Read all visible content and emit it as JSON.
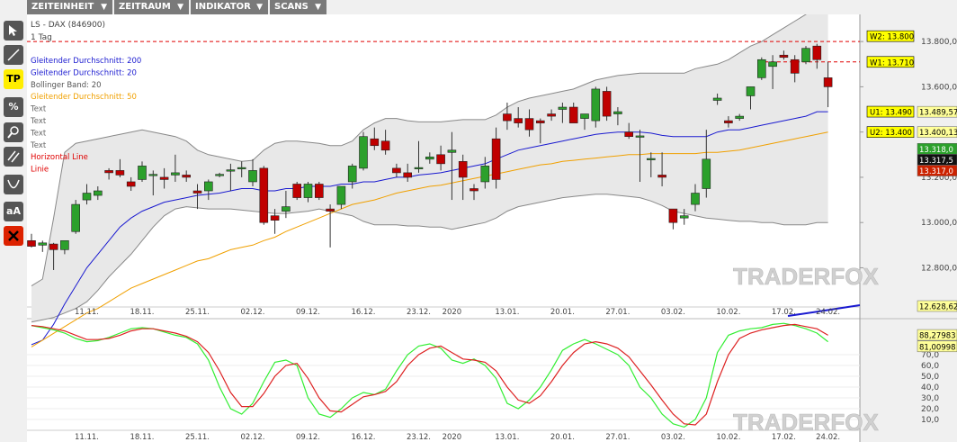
{
  "menu": [
    {
      "label": "ZEITEINHEIT"
    },
    {
      "label": "ZEITRAUM"
    },
    {
      "label": "INDIKATOR"
    },
    {
      "label": "SCANS"
    }
  ],
  "tools": {
    "tp": "TP",
    "percent": "%",
    "text_size": "aA"
  },
  "info": {
    "instrument": "LS - DAX (846900)",
    "timeframe": "1 Tag",
    "legend": [
      {
        "label": "Gleitender Durchschnitt: 200",
        "color": "#1a1ad0"
      },
      {
        "label": "Gleitender Durchschnitt: 20",
        "color": "#1a1ad0"
      },
      {
        "label": "Bollinger Band: 20",
        "color": "#555555"
      },
      {
        "label": "Gleitender Durchschnitt: 50",
        "color": "#f0a000"
      },
      {
        "label": "Text",
        "color": "#666666"
      },
      {
        "label": "Text",
        "color": "#666666"
      },
      {
        "label": "Text",
        "color": "#666666"
      },
      {
        "label": "Text",
        "color": "#666666"
      },
      {
        "label": "Horizontal Line",
        "color": "#e00000"
      },
      {
        "label": "Linie",
        "color": "#e00000"
      }
    ]
  },
  "watermark": "TRADERFOX",
  "price_tags": [
    {
      "text": "W2: 13.800",
      "bg": "#ffff00"
    },
    {
      "text": "W1: 13.710",
      "bg": "#ffff00"
    },
    {
      "text": "U1: 13.490",
      "bg": "#ffff00"
    },
    {
      "text": "U2: 13.400",
      "bg": "#ffff00"
    }
  ],
  "axis_values": [
    {
      "text": "13.489,57",
      "bg": "#ffff99",
      "color": "#000000"
    },
    {
      "text": "13.400,13",
      "bg": "#ffff99",
      "color": "#000000"
    },
    {
      "text": "13.318,0",
      "bg": "#2ca02c",
      "color": "#ffffff"
    },
    {
      "text": "13.317,5",
      "bg": "#111111",
      "color": "#ffffff"
    },
    {
      "text": "13.317,0",
      "bg": "#cc2200",
      "color": "#ffffff"
    },
    {
      "text": "12.628,62",
      "bg": "#ffff99",
      "color": "#000000"
    }
  ],
  "osc_values": [
    {
      "text": "88,27983",
      "bg": "#ffff99",
      "color": "#000000"
    },
    {
      "text": "81,00998",
      "bg": "#ffff99",
      "color": "#000000"
    }
  ],
  "chart_data": [
    {
      "type": "candlestick",
      "title": "LS - DAX (846900)",
      "y_ticks": [
        "13.800,0",
        "13.600,0",
        "13.400,0",
        "13.200,0",
        "13.000,0",
        "12.800,0"
      ],
      "y_tick_values": [
        13800,
        13600,
        13400,
        13200,
        13000,
        12800
      ],
      "ylim": [
        12575,
        13920
      ],
      "x_labels": [
        "11.11.",
        "18.11.",
        "25.11.",
        "02.12.",
        "09.12.",
        "16.12.",
        "23.12.",
        "2020",
        "13.01.",
        "20.01.",
        "27.01.",
        "03.02.",
        "10.02.",
        "17.02.",
        "24.02."
      ],
      "x_label_index": [
        5,
        10,
        15,
        20,
        25,
        30,
        35,
        38,
        43,
        48,
        53,
        58,
        63,
        68,
        72
      ],
      "candles": [
        [
          12920,
          12950,
          12890,
          12895
        ],
        [
          12900,
          12920,
          12870,
          12910
        ],
        [
          12905,
          12910,
          12790,
          12880
        ],
        [
          12880,
          12920,
          12860,
          12920
        ],
        [
          12960,
          13100,
          12950,
          13080
        ],
        [
          13100,
          13170,
          13080,
          13130
        ],
        [
          13120,
          13160,
          13100,
          13140
        ],
        [
          13230,
          13240,
          13190,
          13220
        ],
        [
          13230,
          13280,
          13200,
          13210
        ],
        [
          13180,
          13200,
          13140,
          13160
        ],
        [
          13190,
          13270,
          13180,
          13250
        ],
        [
          13210,
          13230,
          13120,
          13210
        ],
        [
          13200,
          13240,
          13150,
          13190
        ],
        [
          13210,
          13300,
          13180,
          13220
        ],
        [
          13210,
          13230,
          13180,
          13200
        ],
        [
          13140,
          13170,
          13060,
          13130
        ],
        [
          13140,
          13190,
          13100,
          13180
        ],
        [
          13210,
          13220,
          13200,
          13210
        ],
        [
          13230,
          13260,
          13140,
          13230
        ],
        [
          13240,
          13270,
          13200,
          13240
        ],
        [
          13180,
          13280,
          13160,
          13230
        ],
        [
          13240,
          13250,
          12990,
          13000
        ],
        [
          13030,
          13060,
          12950,
          13010
        ],
        [
          13050,
          13140,
          13020,
          13070
        ],
        [
          13170,
          13180,
          13100,
          13110
        ],
        [
          13110,
          13180,
          13090,
          13170
        ],
        [
          13170,
          13180,
          13100,
          13110
        ],
        [
          13060,
          13080,
          12890,
          13050
        ],
        [
          13080,
          13160,
          13060,
          13160
        ],
        [
          13180,
          13260,
          13150,
          13250
        ],
        [
          13240,
          13400,
          13230,
          13380
        ],
        [
          13370,
          13420,
          13320,
          13340
        ],
        [
          13360,
          13410,
          13300,
          13320
        ],
        [
          13240,
          13260,
          13200,
          13220
        ],
        [
          13220,
          13260,
          13180,
          13200
        ],
        [
          13240,
          13360,
          13220,
          13240
        ],
        [
          13280,
          13310,
          13260,
          13290
        ],
        [
          13300,
          13340,
          13230,
          13260
        ],
        [
          13310,
          13400,
          13100,
          13320
        ],
        [
          13270,
          13300,
          13100,
          13200
        ],
        [
          13150,
          13170,
          13100,
          13140
        ],
        [
          13180,
          13290,
          13150,
          13250
        ],
        [
          13370,
          13420,
          13150,
          13190
        ],
        [
          13480,
          13530,
          13410,
          13450
        ],
        [
          13460,
          13510,
          13420,
          13440
        ],
        [
          13460,
          13500,
          13380,
          13410
        ],
        [
          13450,
          13460,
          13350,
          13440
        ],
        [
          13480,
          13500,
          13450,
          13470
        ],
        [
          13500,
          13530,
          13440,
          13510
        ],
        [
          13510,
          13530,
          13460,
          13440
        ],
        [
          13460,
          13480,
          13410,
          13480
        ],
        [
          13450,
          13600,
          13420,
          13590
        ],
        [
          13580,
          13600,
          13450,
          13470
        ],
        [
          13480,
          13510,
          13430,
          13490
        ],
        [
          13400,
          13440,
          13370,
          13380
        ],
        [
          13380,
          13410,
          13180,
          13380
        ],
        [
          13280,
          13310,
          13200,
          13280
        ],
        [
          13210,
          13310,
          13160,
          13200
        ],
        [
          13060,
          13060,
          12970,
          13000
        ],
        [
          13020,
          13060,
          12990,
          13030
        ],
        [
          13080,
          13170,
          13050,
          13130
        ],
        [
          13150,
          13410,
          13110,
          13280
        ],
        [
          13540,
          13570,
          13520,
          13550
        ],
        [
          13450,
          13470,
          13420,
          13440
        ],
        [
          13460,
          13480,
          13450,
          13470
        ],
        [
          13560,
          13600,
          13500,
          13600
        ],
        [
          13640,
          13730,
          13630,
          13720
        ],
        [
          13690,
          13740,
          13590,
          13710
        ],
        [
          13740,
          13760,
          13720,
          13730
        ],
        [
          13720,
          13740,
          13620,
          13660
        ],
        [
          13710,
          13780,
          13700,
          13770
        ],
        [
          13780,
          13790,
          13680,
          13720
        ],
        [
          13640,
          13710,
          13510,
          13600
        ]
      ],
      "ma20": [
        12460,
        12480,
        12550,
        12640,
        12720,
        12800,
        12860,
        12920,
        12980,
        13020,
        13050,
        13070,
        13090,
        13100,
        13110,
        13120,
        13125,
        13130,
        13140,
        13150,
        13150,
        13140,
        13140,
        13150,
        13150,
        13160,
        13160,
        13160,
        13170,
        13170,
        13180,
        13180,
        13190,
        13200,
        13200,
        13210,
        13215,
        13220,
        13230,
        13240,
        13250,
        13260,
        13280,
        13300,
        13320,
        13330,
        13340,
        13350,
        13360,
        13370,
        13380,
        13390,
        13395,
        13400,
        13400,
        13400,
        13395,
        13385,
        13380,
        13380,
        13380,
        13380,
        13400,
        13410,
        13410,
        13420,
        13430,
        13440,
        13450,
        13460,
        13470,
        13490,
        13490
      ],
      "ma50": [
        12450,
        12480,
        12510,
        12540,
        12570,
        12600,
        12620,
        12650,
        12680,
        12710,
        12730,
        12750,
        12770,
        12790,
        12810,
        12830,
        12840,
        12860,
        12880,
        12890,
        12900,
        12920,
        12935,
        12960,
        12980,
        13000,
        13020,
        13040,
        13060,
        13080,
        13090,
        13100,
        13115,
        13130,
        13140,
        13150,
        13160,
        13165,
        13175,
        13185,
        13195,
        13205,
        13215,
        13225,
        13235,
        13245,
        13255,
        13260,
        13270,
        13275,
        13280,
        13285,
        13290,
        13295,
        13300,
        13300,
        13305,
        13305,
        13305,
        13305,
        13305,
        13310,
        13310,
        13315,
        13320,
        13330,
        13340,
        13350,
        13360,
        13370,
        13380,
        13390,
        13400
      ],
      "bb_upper": [
        12720,
        12750,
        13020,
        13310,
        13350,
        13360,
        13370,
        13380,
        13390,
        13400,
        13410,
        13400,
        13390,
        13380,
        13360,
        13320,
        13300,
        13290,
        13280,
        13270,
        13275,
        13320,
        13350,
        13360,
        13360,
        13355,
        13350,
        13340,
        13340,
        13360,
        13410,
        13440,
        13460,
        13460,
        13450,
        13445,
        13445,
        13445,
        13450,
        13455,
        13455,
        13455,
        13475,
        13510,
        13535,
        13550,
        13560,
        13570,
        13580,
        13590,
        13610,
        13630,
        13640,
        13650,
        13655,
        13660,
        13660,
        13660,
        13660,
        13660,
        13680,
        13690,
        13700,
        13720,
        13750,
        13780,
        13800,
        13830,
        13860,
        13890,
        13920,
        13950,
        13960
      ],
      "bb_lower": [
        12560,
        12570,
        12580,
        12600,
        12620,
        12650,
        12700,
        12760,
        12810,
        12860,
        12920,
        12980,
        13030,
        13060,
        13070,
        13065,
        13060,
        13060,
        13060,
        13055,
        13050,
        13045,
        13040,
        13040,
        13045,
        13050,
        13060,
        13050,
        13040,
        13030,
        13005,
        12990,
        12990,
        12990,
        12985,
        12985,
        12980,
        12980,
        12970,
        12980,
        12990,
        13000,
        13020,
        13050,
        13070,
        13080,
        13090,
        13100,
        13110,
        13115,
        13120,
        13125,
        13125,
        13120,
        13115,
        13110,
        13095,
        13075,
        13050,
        13040,
        13030,
        13020,
        13015,
        13010,
        13005,
        13005,
        13000,
        13000,
        12990,
        12990,
        12990,
        13000,
        13000
      ]
    },
    {
      "type": "line",
      "y_ticks": [
        "70,0",
        "60,0",
        "50,0",
        "40,0",
        "30,0",
        "20,0",
        "10,0"
      ],
      "y_tick_values": [
        70,
        60,
        50,
        40,
        30,
        20,
        10
      ],
      "ylim": [
        0,
        100
      ],
      "series": [
        {
          "color": "#33ee33",
          "values": [
            97,
            95,
            93,
            90,
            85,
            82,
            83,
            86,
            90,
            94,
            95,
            94,
            91,
            88,
            86,
            80,
            65,
            40,
            20,
            15,
            25,
            45,
            63,
            65,
            60,
            30,
            15,
            12,
            20,
            30,
            35,
            33,
            38,
            55,
            70,
            78,
            80,
            76,
            65,
            62,
            66,
            60,
            48,
            25,
            20,
            28,
            40,
            56,
            74,
            80,
            84,
            80,
            75,
            70,
            60,
            40,
            30,
            15,
            6,
            3,
            10,
            30,
            72,
            88,
            92,
            94,
            95,
            98,
            99,
            97,
            94,
            90,
            82
          ]
        },
        {
          "color": "#dd2222",
          "values": [
            97,
            96,
            94,
            92,
            88,
            84,
            84,
            85,
            88,
            92,
            94,
            94,
            92,
            90,
            87,
            82,
            72,
            55,
            35,
            22,
            22,
            34,
            50,
            60,
            62,
            48,
            30,
            18,
            17,
            24,
            31,
            33,
            36,
            45,
            60,
            70,
            76,
            78,
            72,
            66,
            65,
            63,
            55,
            40,
            28,
            25,
            32,
            45,
            60,
            72,
            80,
            82,
            80,
            76,
            68,
            55,
            42,
            28,
            15,
            6,
            5,
            15,
            45,
            70,
            85,
            90,
            93,
            95,
            97,
            98,
            96,
            94,
            88
          ]
        }
      ]
    }
  ]
}
